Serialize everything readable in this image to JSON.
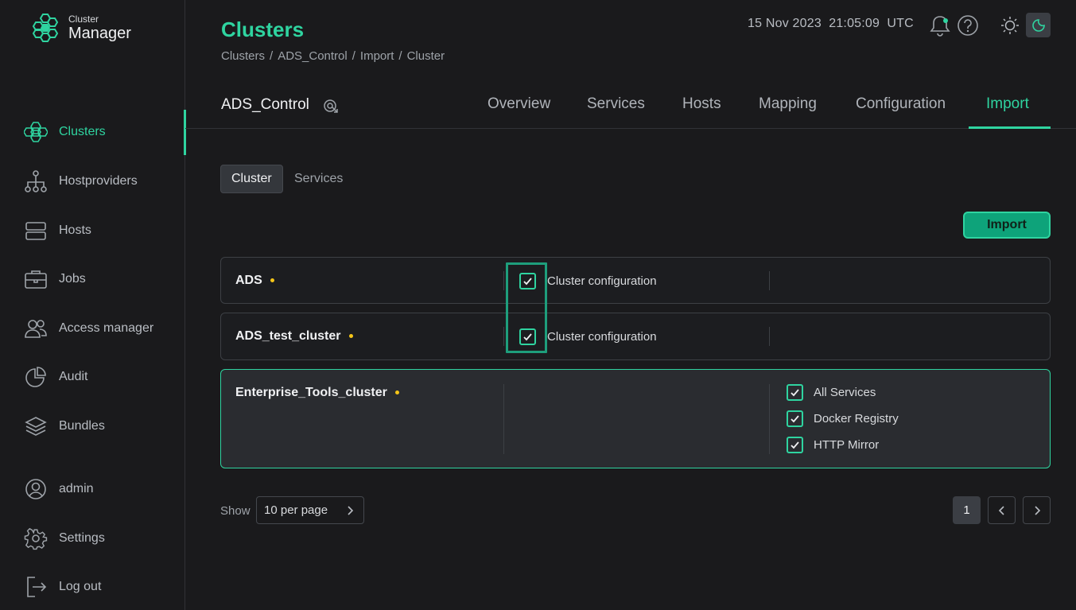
{
  "app": {
    "logo_small": "Cluster",
    "logo_big": "Manager"
  },
  "sidebar": {
    "items": [
      {
        "label": "Clusters",
        "icon": "clusters-icon",
        "active": true
      },
      {
        "label": "Hostproviders",
        "icon": "hostproviders-icon"
      },
      {
        "label": "Hosts",
        "icon": "hosts-icon"
      },
      {
        "label": "Jobs",
        "icon": "jobs-icon"
      },
      {
        "label": "Access manager",
        "icon": "access-manager-icon"
      },
      {
        "label": "Audit",
        "icon": "audit-icon"
      },
      {
        "label": "Bundles",
        "icon": "bundles-icon"
      }
    ],
    "bottom": [
      {
        "label": "admin",
        "icon": "user-icon"
      },
      {
        "label": "Settings",
        "icon": "gear-icon"
      },
      {
        "label": "Log out",
        "icon": "logout-icon"
      }
    ]
  },
  "header": {
    "title": "Clusters",
    "breadcrumbs": [
      "Clusters",
      "ADS_Control",
      "Import",
      "Cluster"
    ],
    "date": "15 Nov 2023",
    "time": "21:05:09",
    "tz": "UTC"
  },
  "cluster": {
    "name": "ADS_Control"
  },
  "tabs": [
    "Overview",
    "Services",
    "Hosts",
    "Mapping",
    "Configuration",
    "Import"
  ],
  "active_tab": "Import",
  "subtabs": [
    "Cluster",
    "Services"
  ],
  "active_subtab": "Cluster",
  "import_button": "Import",
  "rows": [
    {
      "name": "ADS",
      "config_label": "Cluster configuration",
      "config_checked": true
    },
    {
      "name": "ADS_test_cluster",
      "config_label": "Cluster configuration",
      "config_checked": true
    },
    {
      "name": "Enterprise_Tools_cluster",
      "services": [
        "All Services",
        "Docker Registry",
        "HTTP Mirror"
      ]
    }
  ],
  "pagination": {
    "show_label": "Show",
    "per_page": "10 per page",
    "current_page": "1"
  },
  "colors": {
    "accent": "#2fd4a0",
    "background": "#1a1a1c",
    "status_dot": "#f5c518"
  }
}
